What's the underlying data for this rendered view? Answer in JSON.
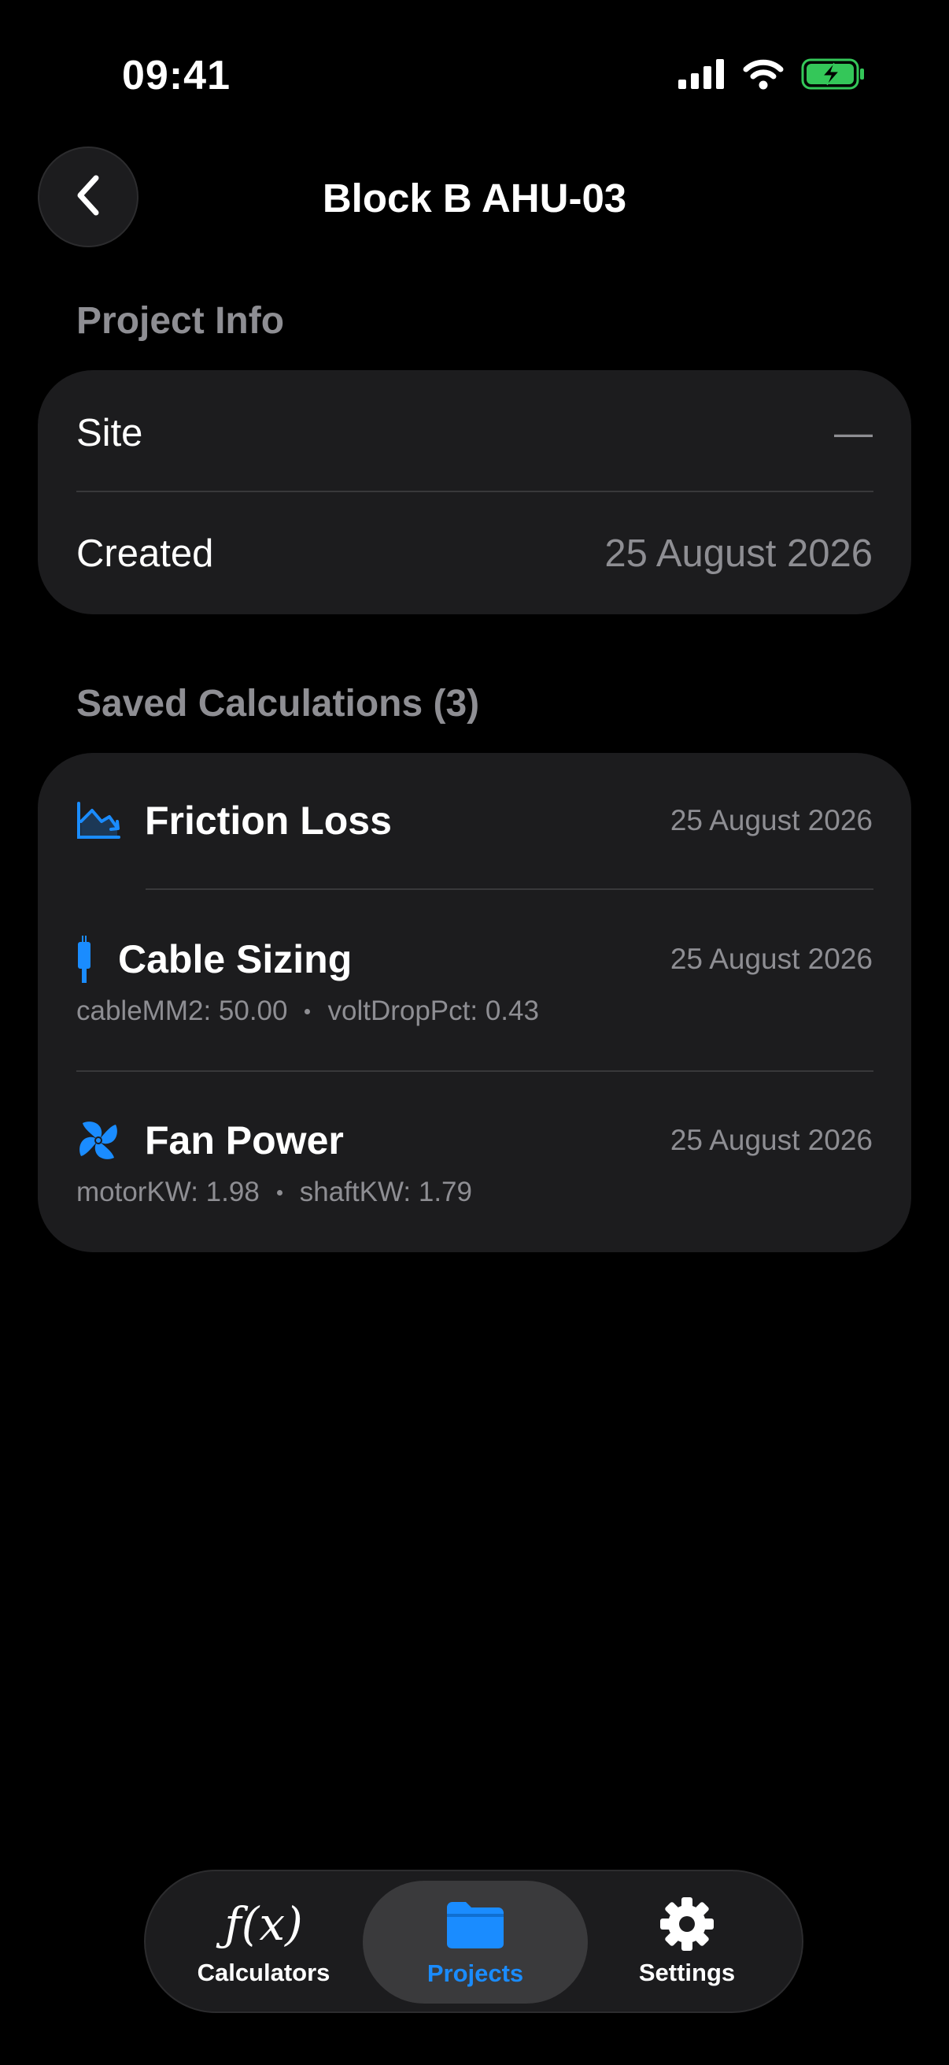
{
  "status_bar": {
    "time": "09:41",
    "signal_icon": "cellular-signal-icon",
    "wifi_icon": "wifi-icon",
    "battery_icon": "battery-charging-icon",
    "battery_color": "#34c759"
  },
  "nav": {
    "back_icon": "chevron-left-icon",
    "title": "Block B AHU-03"
  },
  "project_info": {
    "header": "Project Info",
    "rows": [
      {
        "label": "Site",
        "value": "—"
      },
      {
        "label": "Created",
        "value": "25 August 2026"
      }
    ]
  },
  "saved_calculations": {
    "header": "Saved Calculations (3)",
    "items": [
      {
        "icon": "chart-line-downtrend-icon",
        "title": "Friction Loss",
        "date": "25 August 2026",
        "details": []
      },
      {
        "icon": "cable-connector-icon",
        "title": "Cable Sizing",
        "date": "25 August 2026",
        "details": [
          "cableMM2: 50.00",
          "voltDropPct: 0.43"
        ]
      },
      {
        "icon": "fan-icon",
        "title": "Fan Power",
        "date": "25 August 2026",
        "details": [
          "motorKW: 1.98",
          "shaftKW: 1.79"
        ]
      }
    ]
  },
  "tab_bar": {
    "tabs": [
      {
        "label": "Calculators",
        "icon": "function-icon",
        "glyph": "ƒ(x)",
        "active": false
      },
      {
        "label": "Projects",
        "icon": "folder-icon",
        "active": true
      },
      {
        "label": "Settings",
        "icon": "gear-icon",
        "active": false
      }
    ]
  },
  "colors": {
    "accent": "#1a8cff",
    "background": "#000000",
    "card": "#1c1c1e",
    "secondary_text": "#8e8e93"
  }
}
